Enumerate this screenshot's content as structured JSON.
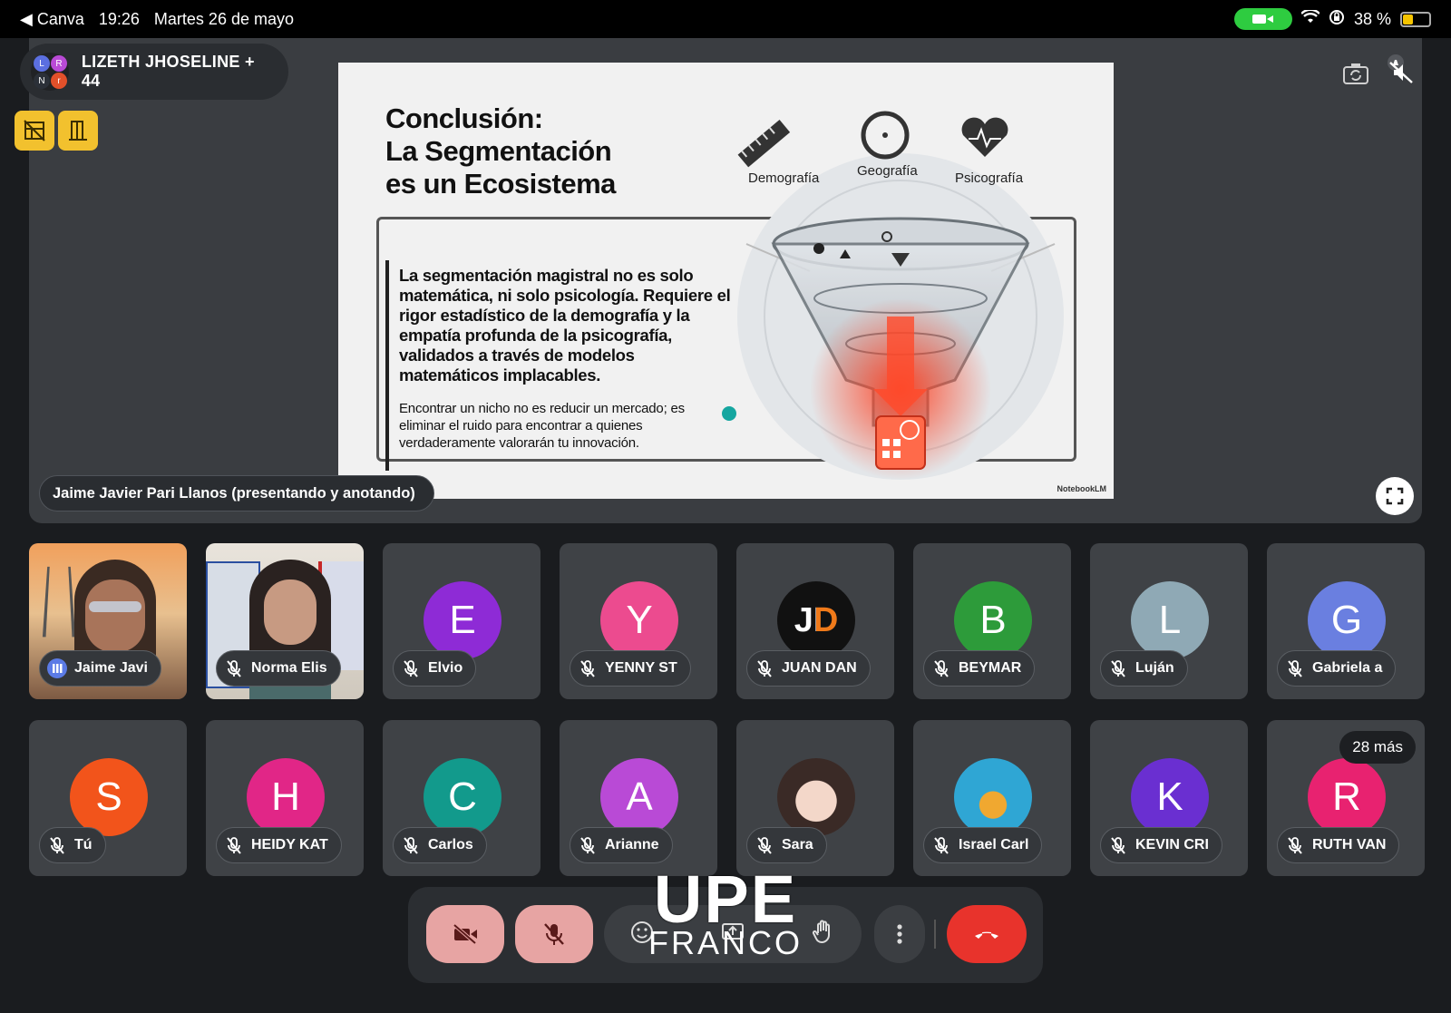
{
  "status_bar": {
    "back_app": "Canva",
    "time": "19:26",
    "date": "Martes 26 de mayo",
    "battery": "38 %",
    "battery_level": 0.38
  },
  "meeting": {
    "participants_label": "LIZETH JHOSELINE + 44",
    "avatar_initials": [
      "L",
      "R",
      "N",
      "r"
    ],
    "presenting_label": "Jaime Javier Pari Llanos (presentando y anotando)"
  },
  "slide": {
    "title_line1": "Conclusión:",
    "title_line2": "La Segmentación",
    "title_line3": "es un Ecosistema",
    "labels": [
      "Demografía",
      "Geografía",
      "Psicografía"
    ],
    "body_main": "La segmentación magistral no es solo matemática, ni solo psicología. Requiere el rigor estadístico de la demografía y la empatía profunda de la psicografía, validados a través de modelos matemáticos implacables.",
    "body_sub": "Encontrar un nicho no es reducir un mercado; es eliminar el ruido para encontrar a quienes verdaderamente valorarán tu innovación.",
    "watermark": "NotebookLM"
  },
  "participants": [
    {
      "name": "Jaime Javi",
      "initial": "",
      "color": "#8a6a4a",
      "video": true
    },
    {
      "name": "Norma Elis",
      "initial": "",
      "color": "#b8b2a8",
      "video": true
    },
    {
      "name": "Elvio",
      "initial": "E",
      "color": "#8e2bd6"
    },
    {
      "name": "YENNY ST",
      "initial": "Y",
      "color": "#ec4b8f"
    },
    {
      "name": "JUAN DAN",
      "initial": "JD",
      "color": "#111111"
    },
    {
      "name": "BEYMAR",
      "initial": "B",
      "color": "#2d9b3a"
    },
    {
      "name": "Luján",
      "initial": "L",
      "color": "#8fa9b5"
    },
    {
      "name": "Gabriela a",
      "initial": "G",
      "color": "#6a7fe0"
    },
    {
      "name": "Tú",
      "initial": "S",
      "color": "#f2541b"
    },
    {
      "name": "HEIDY KAT",
      "initial": "H",
      "color": "#e12687"
    },
    {
      "name": "Carlos",
      "initial": "C",
      "color": "#129a8c"
    },
    {
      "name": "Arianne",
      "initial": "A",
      "color": "#b94ad6"
    },
    {
      "name": "Sara",
      "initial": "",
      "color": "#d8c8c2",
      "photo": true
    },
    {
      "name": "Israel Carl",
      "initial": "",
      "color": "#32b5de",
      "photo": true
    },
    {
      "name": "KEVIN CRI",
      "initial": "K",
      "color": "#6a2fd1"
    },
    {
      "name": "RUTH VAN",
      "initial": "R",
      "color": "#e82270"
    }
  ],
  "more_badge": "28 más",
  "brand": {
    "line1": "UPE",
    "line2": "FRANCO"
  }
}
